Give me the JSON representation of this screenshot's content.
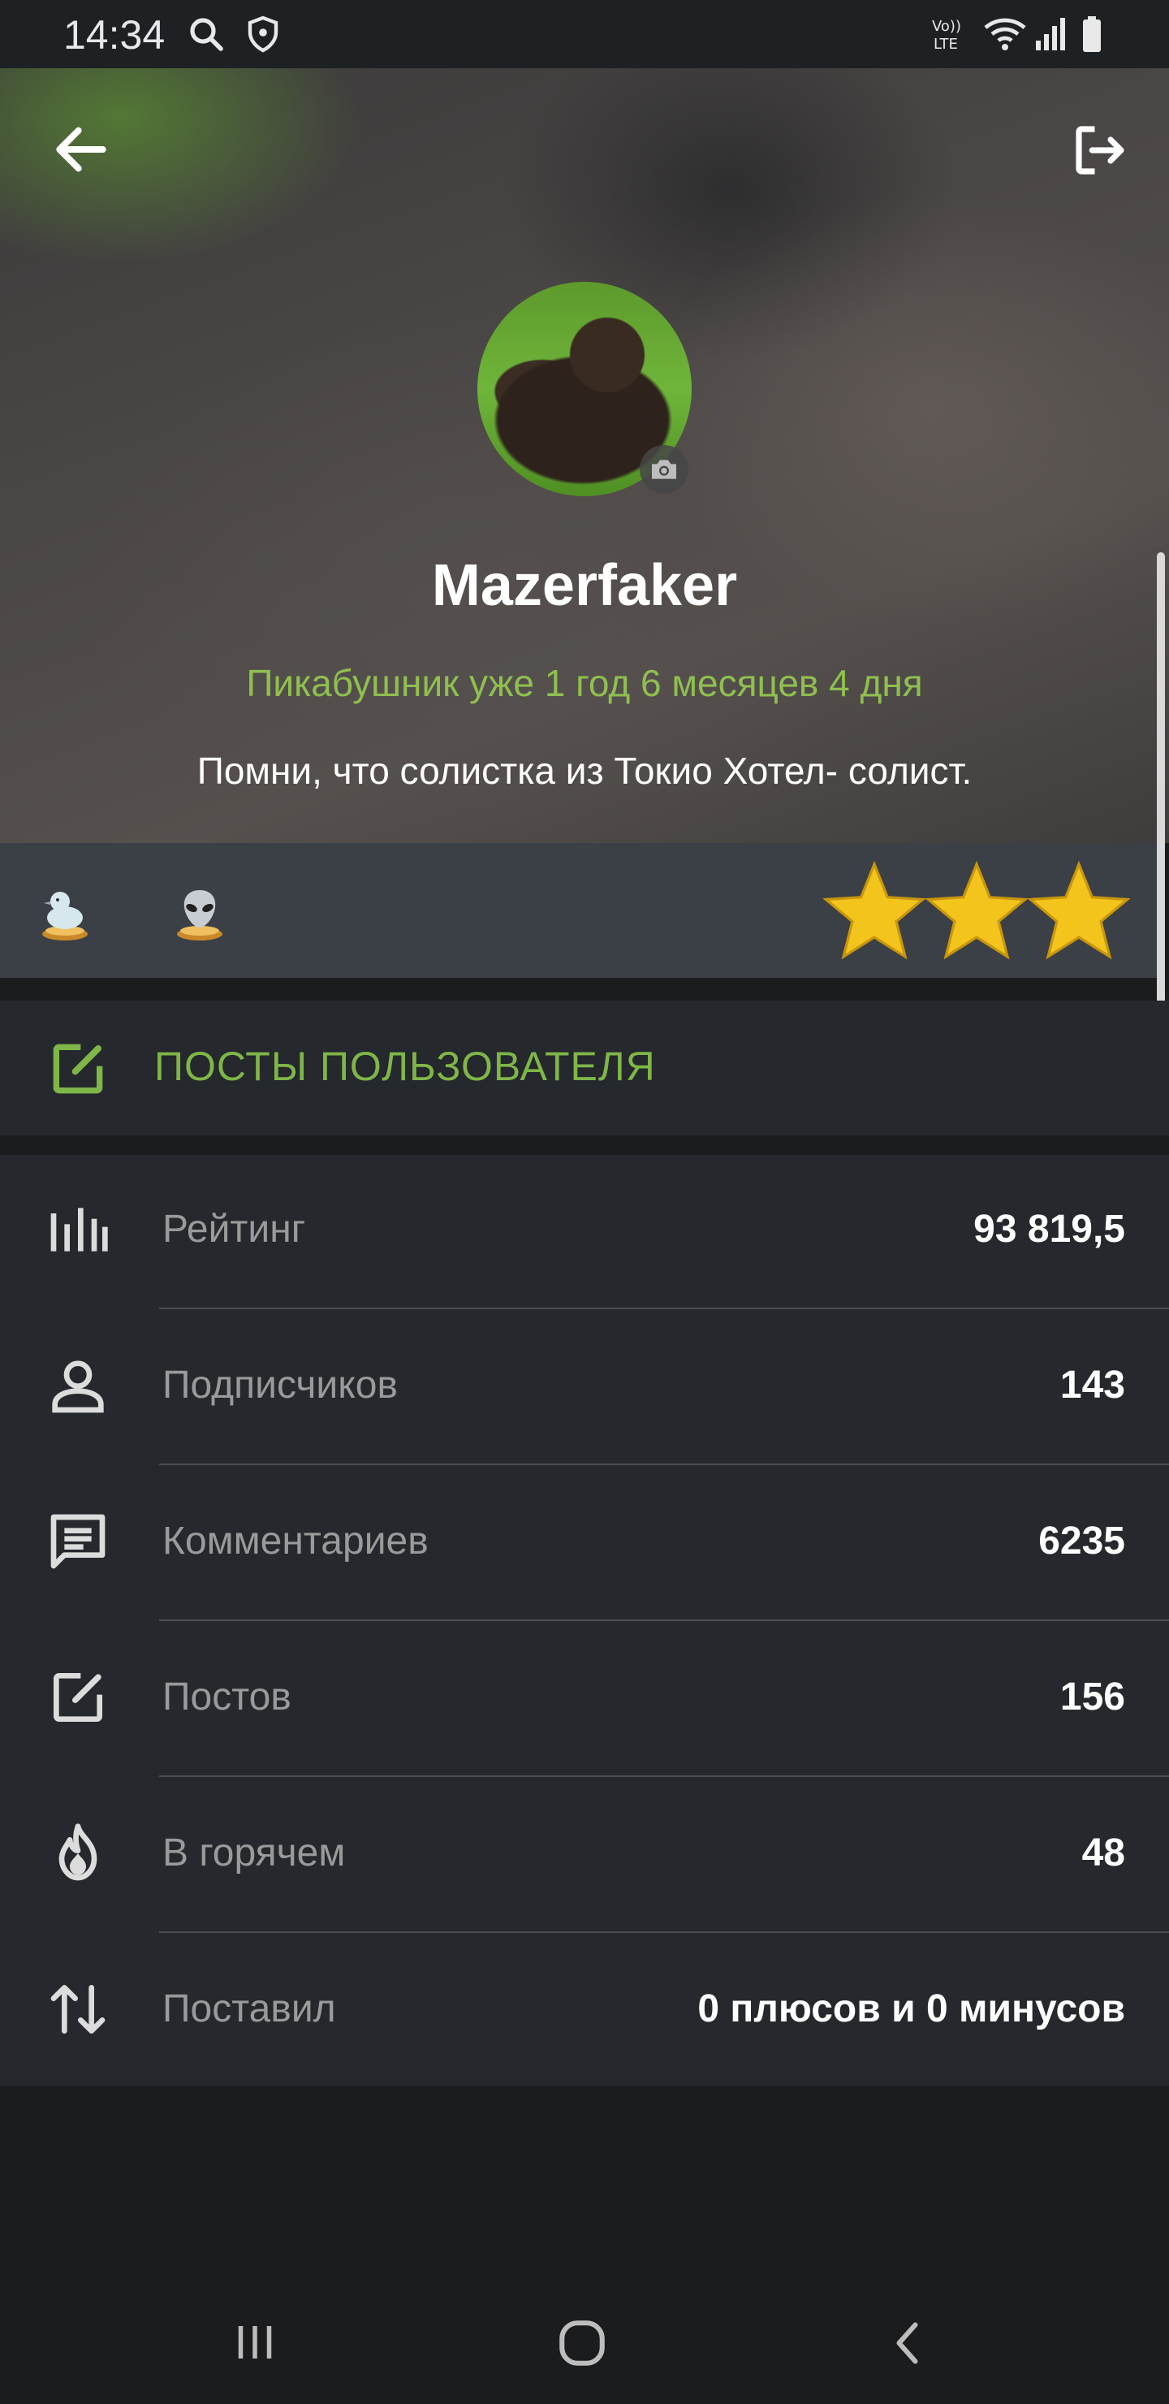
{
  "status_bar": {
    "time": "14:34",
    "icons": [
      "search-icon",
      "shield-icon",
      "volte-icon",
      "wifi-icon",
      "signal-icon",
      "battery-icon"
    ]
  },
  "header": {
    "back_icon": "arrow-left-icon",
    "logout_icon": "logout-icon"
  },
  "profile": {
    "username": "Mazerfaker",
    "member_since": "Пикабушник уже 1 год 6 месяцев 4 дня",
    "bio": "Помни, что солистка из Токио Хотел- солист.",
    "avatar_icon": "chimpanzee-avatar",
    "camera_icon": "camera-icon"
  },
  "awards": {
    "badges": [
      "duck-award-icon",
      "alien-award-icon"
    ],
    "stars": 3
  },
  "posts_section": {
    "label": "ПОСТЫ ПОЛЬЗОВАТЕЛЯ",
    "icon": "edit-icon"
  },
  "stats": [
    {
      "label": "Рейтинг",
      "value": "93 819,5",
      "icon": "bar-chart-icon"
    },
    {
      "label": "Подписчиков",
      "value": "143",
      "icon": "person-icon"
    },
    {
      "label": "Комментариев",
      "value": "6235",
      "icon": "comment-icon"
    },
    {
      "label": "Постов",
      "value": "156",
      "icon": "edit-icon"
    },
    {
      "label": "В горячем",
      "value": "48",
      "icon": "fire-icon"
    },
    {
      "label": "Поставил",
      "value": "0 плюсов и 0 минусов",
      "icon": "sort-arrows-icon"
    }
  ],
  "colors": {
    "accent_green": "#7fb648",
    "member_since_green": "#8fbf4f",
    "panel_dark": "#25282c",
    "awards_bar": "#3b4047"
  },
  "nav_bar": {
    "icons": [
      "recent-apps-icon",
      "home-icon",
      "back-icon"
    ]
  }
}
